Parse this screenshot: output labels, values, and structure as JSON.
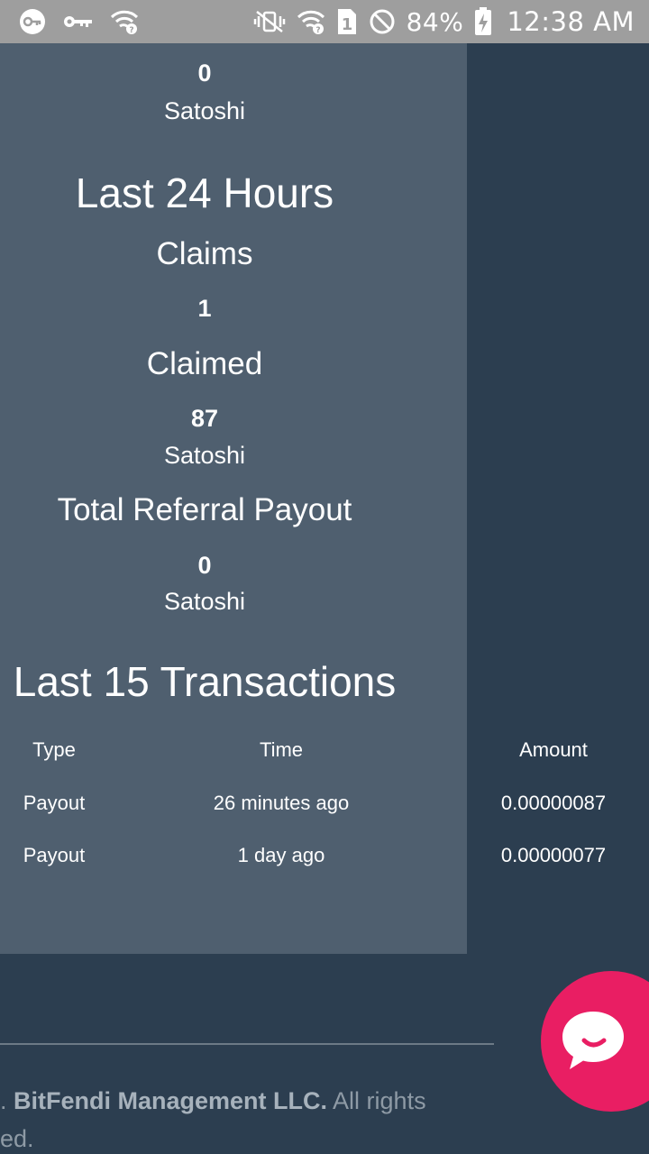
{
  "status_bar": {
    "battery": "84%",
    "sim_number": "1",
    "time": "12:38 AM",
    "icons_left": [
      "vpn-key-icon",
      "key-icon",
      "wifi-question-icon"
    ],
    "icons_right": [
      "muted-vibrate-icon",
      "wifi-question-icon",
      "sim-icon",
      "blocked-icon",
      "battery-charging-icon"
    ]
  },
  "referral_top": {
    "value": "0",
    "unit": "Satoshi"
  },
  "last24": {
    "title": "Last 24 Hours",
    "claims_label": "Claims",
    "claims_value": "1",
    "claimed_label": "Claimed",
    "claimed_value": "87",
    "claimed_unit": "Satoshi",
    "referral_label": "Total Referral Payout",
    "referral_value": "0",
    "referral_unit": "Satoshi"
  },
  "transactions": {
    "title": "Last 15 Transactions",
    "columns": [
      "Type",
      "Time",
      "Amount"
    ],
    "rows": [
      {
        "type": "Payout",
        "time": "26 minutes ago",
        "amount": "0.00000087"
      },
      {
        "type": "Payout",
        "time": "1 day ago",
        "amount": "0.00000077"
      }
    ]
  },
  "footer": {
    "prefix": ". ",
    "company": "BitFendi Management LLC.",
    "suffix": " All rights",
    "line2": "ed."
  },
  "colors": {
    "page_bg": "#2c3e50",
    "panel_bg": "#4f5f6f",
    "chat_button": "#e91e63"
  }
}
